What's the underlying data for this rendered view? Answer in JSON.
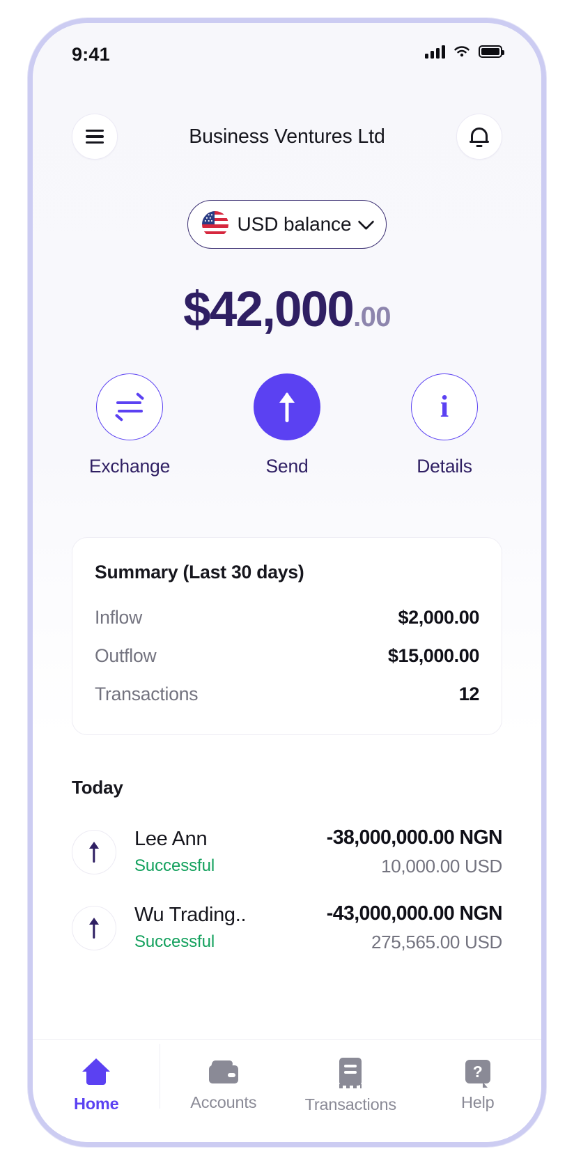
{
  "status_bar": {
    "time": "9:41",
    "signal_icon": "cellular-signal-icon",
    "wifi_icon": "wifi-icon",
    "battery_icon": "battery-icon"
  },
  "header": {
    "menu_icon": "hamburger-menu-icon",
    "title": "Business Ventures Ltd",
    "notification_icon": "bell-icon"
  },
  "balance": {
    "currency_selector": {
      "flag_icon": "us-flag-icon",
      "label": "USD balance",
      "chevron_icon": "chevron-down-icon"
    },
    "amount_main": "$42,000",
    "amount_cents": ".00"
  },
  "actions": [
    {
      "id": "exchange",
      "label": "Exchange",
      "icon": "exchange-arrows-icon",
      "primary": false
    },
    {
      "id": "send",
      "label": "Send",
      "icon": "arrow-up-icon",
      "primary": true
    },
    {
      "id": "details",
      "label": "Details",
      "icon": "info-icon",
      "primary": false
    }
  ],
  "summary": {
    "title": "Summary (Last 30 days)",
    "rows": [
      {
        "label": "Inflow",
        "value": "$2,000.00"
      },
      {
        "label": "Outflow",
        "value": "$15,000.00"
      },
      {
        "label": "Transactions",
        "value": "12"
      }
    ]
  },
  "transactions": {
    "group_heading": "Today",
    "items": [
      {
        "icon": "arrow-up-icon",
        "name": "Lee Ann",
        "status": "Successful",
        "amount": "-38,000,000.00 NGN",
        "converted": "10,000.00 USD"
      },
      {
        "icon": "arrow-up-icon",
        "name": "Wu Trading..",
        "status": "Successful",
        "amount": "-43,000,000.00 NGN",
        "converted": "275,565.00 USD"
      }
    ]
  },
  "tabbar": {
    "items": [
      {
        "id": "home",
        "label": "Home",
        "icon": "home-icon",
        "active": true
      },
      {
        "id": "accounts",
        "label": "Accounts",
        "icon": "wallet-icon",
        "active": false
      },
      {
        "id": "transactions",
        "label": "Transactions",
        "icon": "receipt-icon",
        "active": false
      },
      {
        "id": "help",
        "label": "Help",
        "icon": "help-chat-icon",
        "active": false
      }
    ]
  },
  "colors": {
    "accent": "#5b41f2",
    "balance_text": "#2f1f63",
    "cents_text": "#8d85ad",
    "success": "#12a05c",
    "muted": "#73737f",
    "frame": "#ccccf2"
  }
}
